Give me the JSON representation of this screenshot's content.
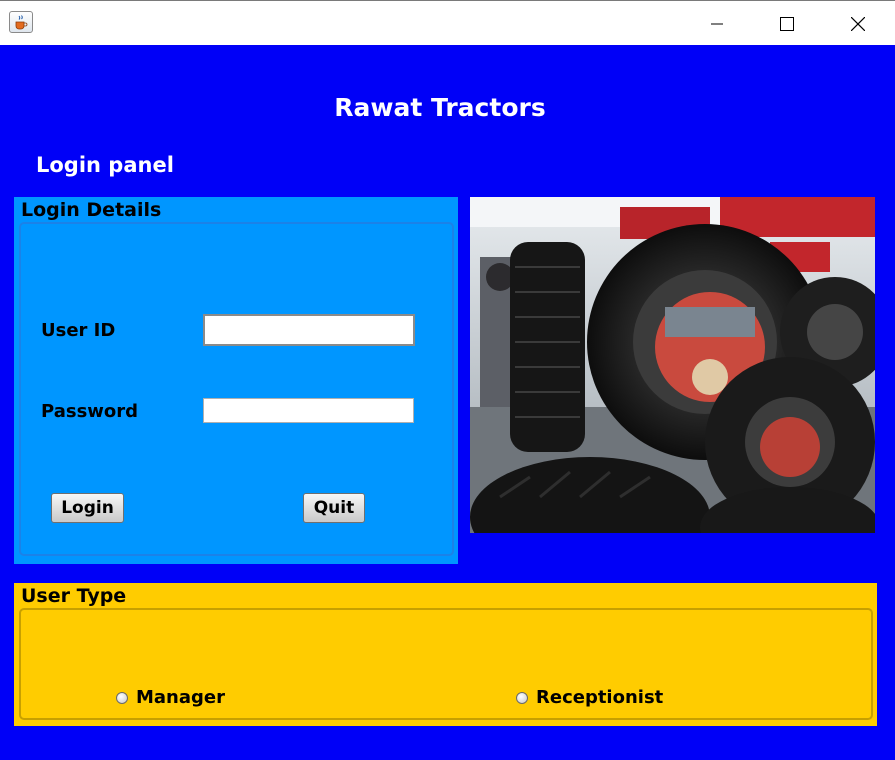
{
  "window": {
    "icon": "java-cup-icon",
    "controls": {
      "minimize": "minimize-icon",
      "maximize": "maximize-icon",
      "close": "close-icon"
    }
  },
  "header": {
    "title": "Rawat Tractors",
    "section_label": "Login panel"
  },
  "login_panel": {
    "legend": "Login Details",
    "user_id_label": "User ID",
    "user_id_value": "",
    "password_label": "Password",
    "password_value": "",
    "login_button": "Login",
    "quit_button": "Quit"
  },
  "user_type": {
    "legend": "User Type",
    "options": [
      {
        "label": "Manager",
        "selected": false
      },
      {
        "label": "Receptionist",
        "selected": false
      }
    ]
  },
  "colors": {
    "background": "#0000f7",
    "login_panel": "#0096ff",
    "user_type_panel": "#ffcc00",
    "title_text": "#ffffff"
  }
}
